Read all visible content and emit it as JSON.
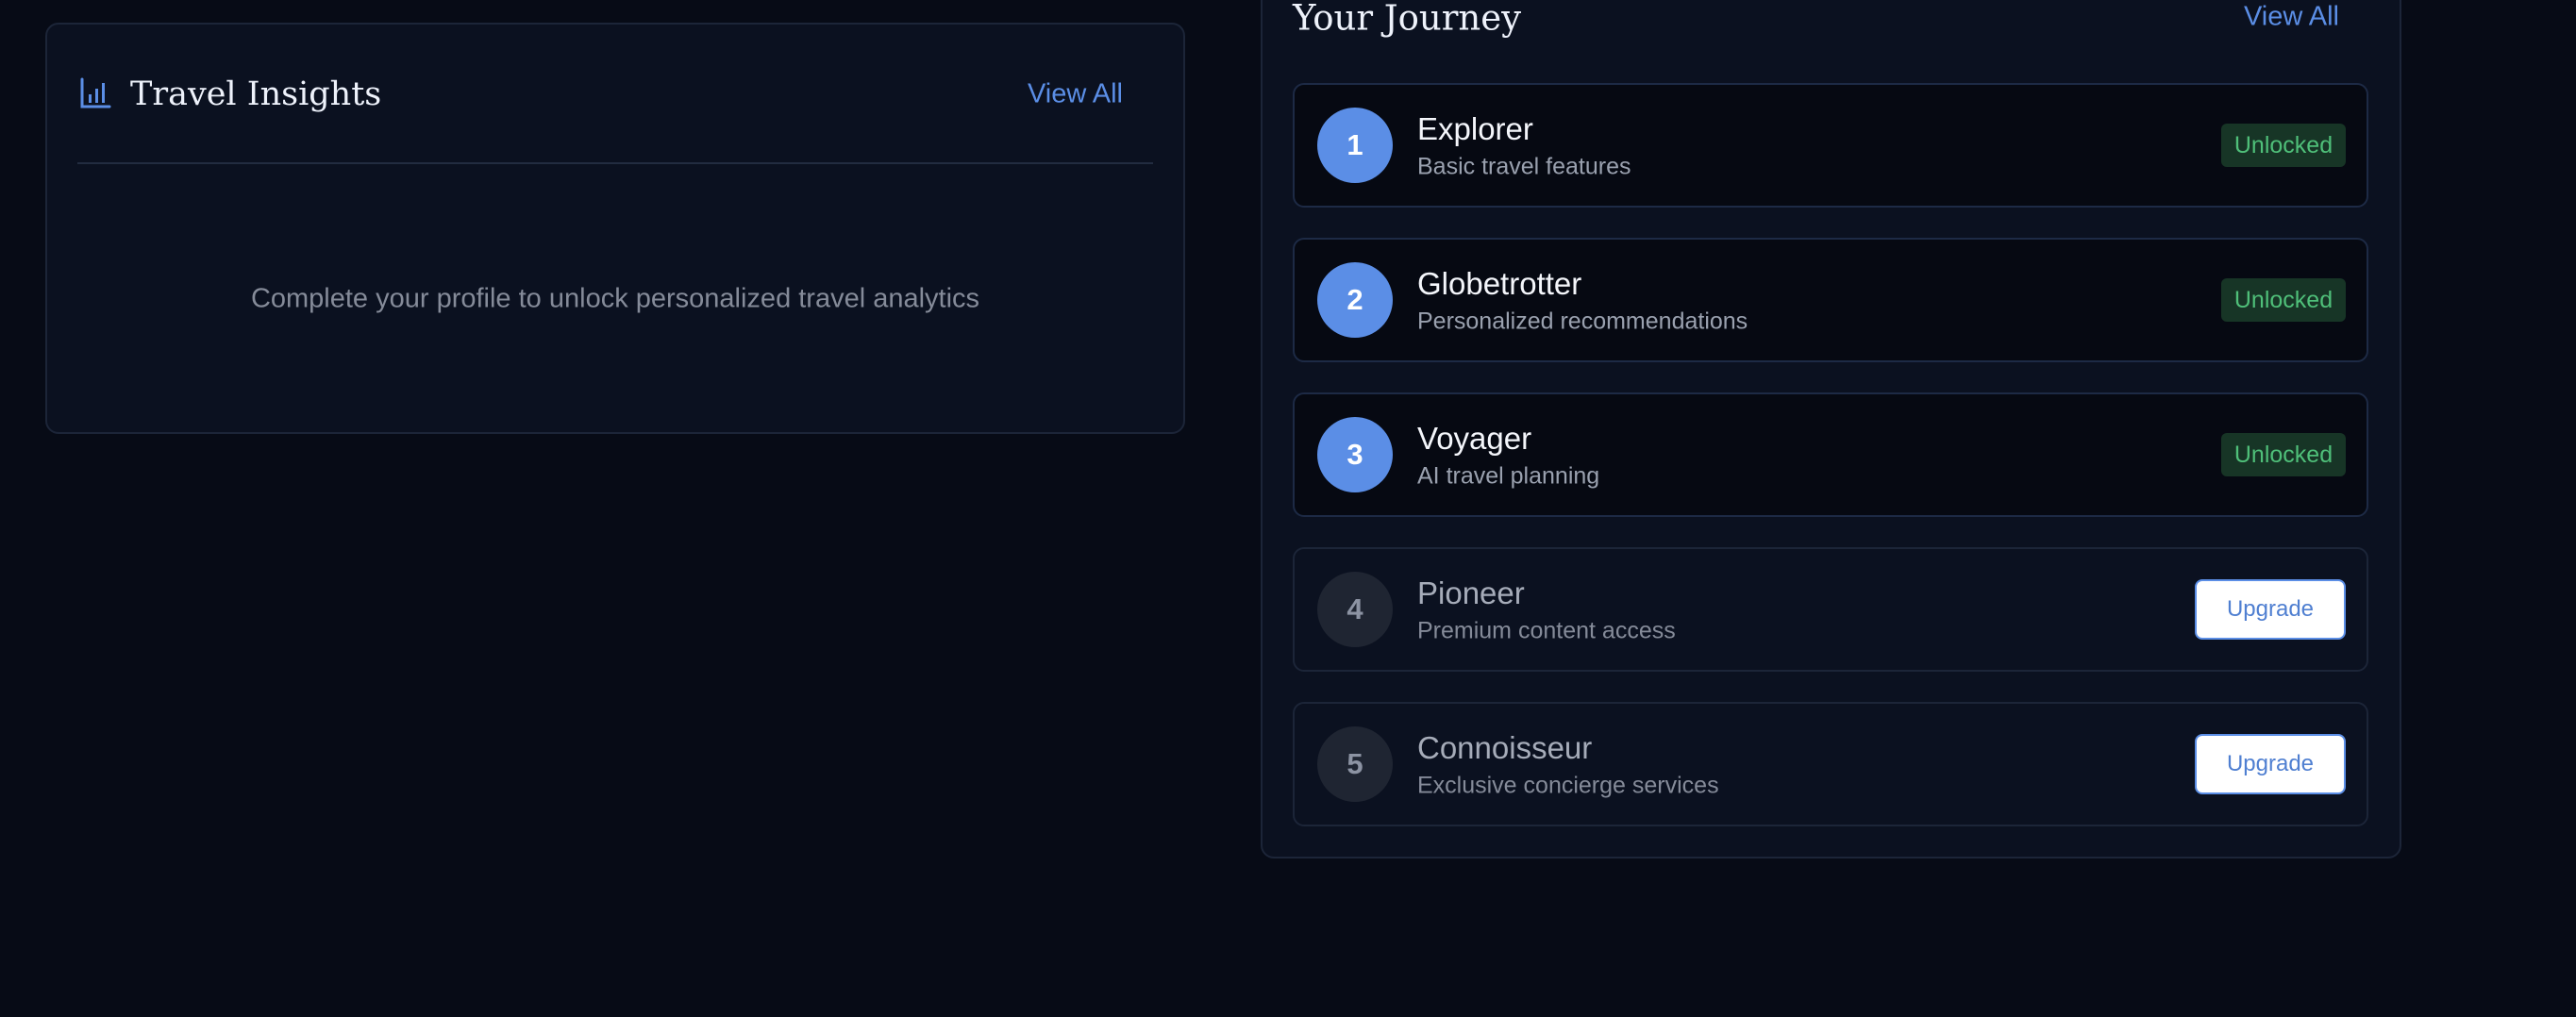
{
  "insights": {
    "title": "Travel Insights",
    "view_all_label": "View All",
    "empty_message": "Complete your profile to unlock personalized travel analytics",
    "icon": "bar-chart-icon"
  },
  "journey": {
    "title": "Your Journey",
    "view_all_label": "View All",
    "levels": [
      {
        "number": "1",
        "name": "Explorer",
        "description": "Basic travel features",
        "status": "Unlocked"
      },
      {
        "number": "2",
        "name": "Globetrotter",
        "description": "Personalized recommendations",
        "status": "Unlocked"
      },
      {
        "number": "3",
        "name": "Voyager",
        "description": "AI travel planning",
        "status": "Unlocked"
      },
      {
        "number": "4",
        "name": "Pioneer",
        "description": "Premium content access",
        "action": "Upgrade"
      },
      {
        "number": "5",
        "name": "Connoisseur",
        "description": "Exclusive concierge services",
        "action": "Upgrade"
      }
    ]
  },
  "colors": {
    "background": "#070b16",
    "card": "#0b1120",
    "accent": "#5b8ee6",
    "unlocked_text": "#4fbf79",
    "unlocked_bg": "#173526"
  }
}
